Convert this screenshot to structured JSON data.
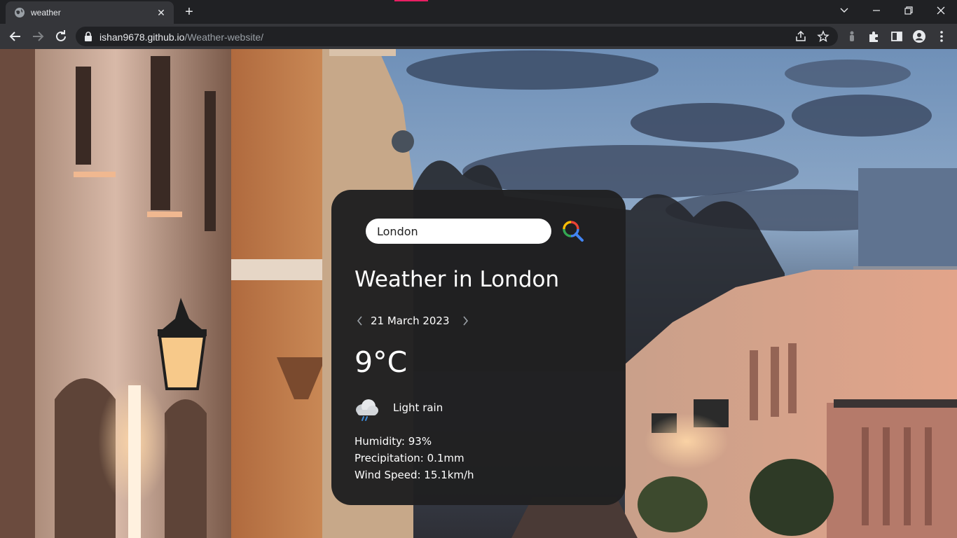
{
  "browser": {
    "tab": {
      "title": "weather",
      "favicon": "globe-icon"
    },
    "url": {
      "host": "ishan9678.github.io",
      "path": "/Weather-website/"
    }
  },
  "weather": {
    "search": {
      "value": "London"
    },
    "title": "Weather in London",
    "date": "21 March 2023",
    "temperature": "9°C",
    "condition": {
      "text": "Light rain",
      "icon": "light-rain-cloud-icon"
    },
    "humidity": "Humidity: 93%",
    "precipitation": "Precipitation: 0.1mm",
    "wind": "Wind Speed: 15.1km/h"
  },
  "colors": {
    "card_background": "#202021",
    "accent": "#e91e63"
  }
}
